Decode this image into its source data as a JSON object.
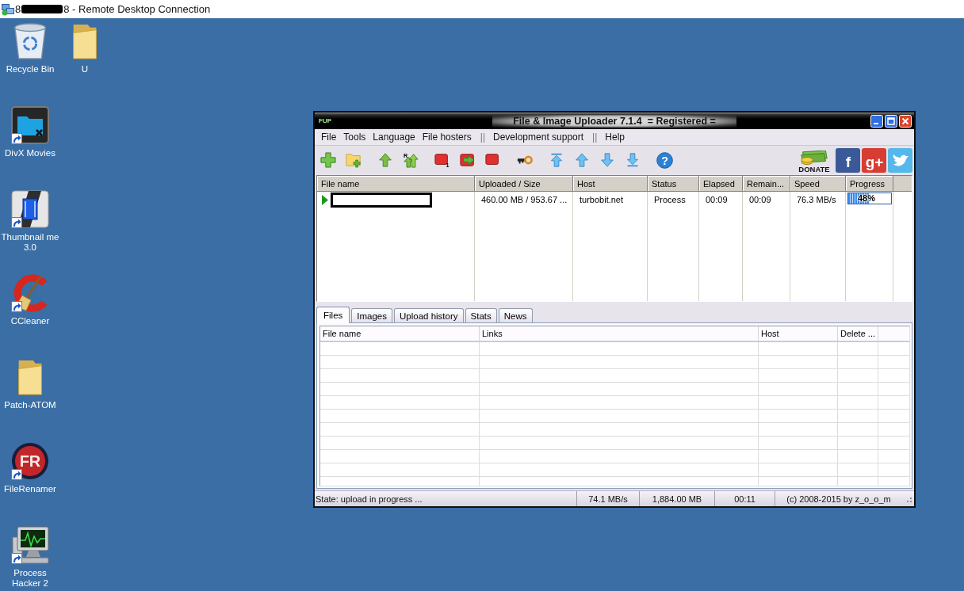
{
  "remote_desktop": {
    "title_start": "8",
    "title_end": "8 - Remote Desktop Connection",
    "redacted": true
  },
  "desktop": {
    "columns": [
      {
        "icons": [
          {
            "label": "Recycle Bin",
            "kind": "recycle-bin",
            "shortcut": false
          },
          {
            "label": "DivX Movies",
            "kind": "folder-tile",
            "shortcut": true
          },
          {
            "label": "Thumbnail me 3.0",
            "kind": "film-tile",
            "shortcut": true
          },
          {
            "label": "CCleaner",
            "kind": "brush-c",
            "shortcut": true
          },
          {
            "label": "Patch-ATOM",
            "kind": "folder",
            "shortcut": false
          },
          {
            "label": "FileRenamer",
            "kind": "letter-disc",
            "glyph": "FR",
            "shortcut": true
          },
          {
            "label": "Process Hacker 2",
            "kind": "monitor",
            "shortcut": true
          }
        ]
      },
      {
        "icons": [
          {
            "label": "U",
            "kind": "folder",
            "shortcut": false
          }
        ]
      }
    ]
  },
  "app": {
    "logo": "FUP",
    "title": "File & Image Uploader 7.1.4  = Registered =",
    "menu": [
      {
        "kind": "item",
        "label": "File"
      },
      {
        "kind": "item",
        "label": "Tools"
      },
      {
        "kind": "item",
        "label": "Language"
      },
      {
        "kind": "item",
        "label": "File hosters"
      },
      {
        "kind": "separator",
        "label": "||"
      },
      {
        "kind": "item",
        "label": "Development support"
      },
      {
        "kind": "separator",
        "label": "||"
      },
      {
        "kind": "item",
        "label": "Help"
      }
    ],
    "toolbar": {
      "groups": [
        {
          "buttons": [
            {
              "kind": "plus"
            },
            {
              "kind": "folder-plus"
            }
          ]
        },
        {
          "buttons": [
            {
              "kind": "arrow-up"
            },
            {
              "kind": "double-arrow-up",
              "badge": "R"
            }
          ]
        },
        {
          "buttons": [
            {
              "kind": "square",
              "badge": "1"
            },
            {
              "kind": "square-arrow"
            },
            {
              "kind": "square"
            }
          ]
        },
        {
          "buttons": [
            {
              "kind": "key"
            }
          ]
        },
        {
          "buttons": [
            {
              "kind": "arrow-top"
            },
            {
              "kind": "arrow-up-blue"
            },
            {
              "kind": "arrow-down-blue"
            },
            {
              "kind": "arrow-bottom"
            }
          ]
        },
        {
          "buttons": [
            {
              "kind": "help",
              "badge": "?"
            }
          ]
        }
      ]
    },
    "donate": {
      "label": "DONATE"
    },
    "social": [
      {
        "kind": "letter-tile",
        "color": "#3b5998",
        "glyph": "f"
      },
      {
        "kind": "letter-tile",
        "color": "#d73d32",
        "glyph": "g+"
      },
      {
        "kind": "bird-tile",
        "color": "#55b8ea"
      }
    ],
    "transfers": {
      "columns": [
        "File name",
        "Uploaded / Size",
        "Host",
        "Status",
        "Elapsed",
        "Remain...",
        "Speed",
        "Progress"
      ],
      "rows": [
        {
          "running": true,
          "file_name_redacted": true,
          "uploaded_size": "460.00 MB / 953.67 ...",
          "host": "turbobit.net",
          "status": "Process",
          "elapsed": "00:09",
          "remaining": "00:09",
          "speed": "76.3 MB/s",
          "progress": {
            "level": 0.48,
            "label": "48%"
          }
        }
      ]
    },
    "tabs": [
      {
        "label": "Files",
        "selected": true
      },
      {
        "label": "Images",
        "selected": false
      },
      {
        "label": "Upload history",
        "selected": false
      },
      {
        "label": "Stats",
        "selected": false
      },
      {
        "label": "News",
        "selected": false
      }
    ],
    "files_table": {
      "columns": [
        "File name",
        "Links",
        "Host",
        "Delete ..."
      ]
    },
    "status_bar": [
      "State: upload in progress ...",
      "74.1 MB/s",
      "1,884.00 MB",
      "00:11",
      "(c) 2008-2015 by z_o_o_m"
    ]
  }
}
